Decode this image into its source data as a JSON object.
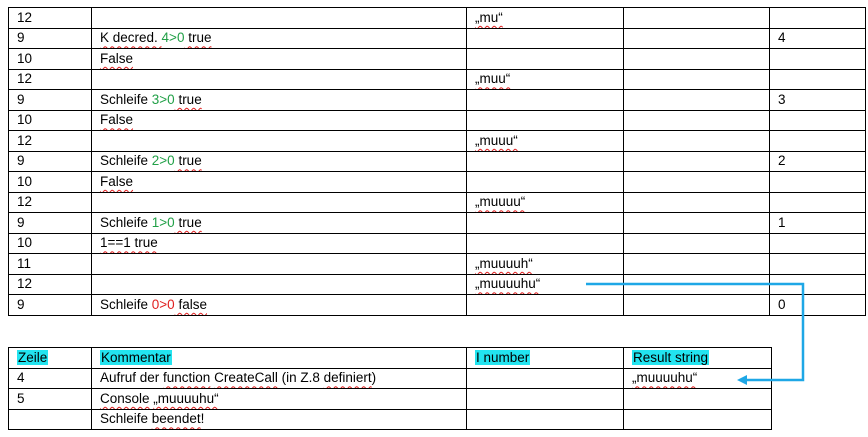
{
  "trace_rows": [
    {
      "zeile": "12",
      "pre": "",
      "num": "",
      "post": "",
      "string": "„mu“",
      "result": "",
      "count": ""
    },
    {
      "zeile": "9",
      "pre": "K decred. ",
      "num": "4>0",
      "post": " true",
      "string": "",
      "result": "",
      "count": "4"
    },
    {
      "zeile": "10",
      "pre": "False",
      "num": "",
      "post": "",
      "string": "",
      "result": "",
      "count": ""
    },
    {
      "zeile": "12",
      "pre": "",
      "num": "",
      "post": "",
      "string": "„muu“",
      "result": "",
      "count": ""
    },
    {
      "zeile": "9",
      "pre": "Schleife ",
      "num": "3>0",
      "post": " true",
      "string": "",
      "result": "",
      "count": "3"
    },
    {
      "zeile": "10",
      "pre": "False",
      "num": "",
      "post": "",
      "string": "",
      "result": "",
      "count": ""
    },
    {
      "zeile": "12",
      "pre": "",
      "num": "",
      "post": "",
      "string": "„muuu“",
      "result": "",
      "count": ""
    },
    {
      "zeile": "9",
      "pre": "Schleife ",
      "num": "2>0",
      "post": " true",
      "string": "",
      "result": "",
      "count": "2"
    },
    {
      "zeile": "10",
      "pre": "False",
      "num": "",
      "post": "",
      "string": "",
      "result": "",
      "count": ""
    },
    {
      "zeile": "12",
      "pre": "",
      "num": "",
      "post": "",
      "string": "„muuuu“",
      "result": "",
      "count": ""
    },
    {
      "zeile": "9",
      "pre": "Schleife ",
      "num": "1>0",
      "post": " true",
      "string": "",
      "result": "",
      "count": "1"
    },
    {
      "zeile": "10",
      "pre": "1==1 true",
      "num": "",
      "post": "",
      "string": "",
      "result": "",
      "count": ""
    },
    {
      "zeile": "11",
      "pre": "",
      "num": "",
      "post": "",
      "string": "„muuuuh“",
      "result": "",
      "count": ""
    },
    {
      "zeile": "12",
      "pre": "",
      "num": "",
      "post": "",
      "string": "„muuuuhu“",
      "result": "",
      "count": ""
    },
    {
      "zeile": "9",
      "pre": "Schleife ",
      "num": "0>0",
      "post": " false",
      "string": "",
      "result": "",
      "count": "0"
    }
  ],
  "legend": {
    "headers": {
      "zeile": "Zeile",
      "kommentar": "Kommentar",
      "number": "I number",
      "result": "Result string"
    },
    "rows": [
      {
        "zeile": "4",
        "kommentar": "Aufruf der function CreateCall (in Z.8 definiert)",
        "number": "",
        "result": "„muuuuhu“"
      },
      {
        "zeile": "5",
        "kommentar": "Console „muuuuhu“",
        "number": "",
        "result": ""
      },
      {
        "zeile": "",
        "kommentar": "Schleife beendet!",
        "number": "",
        "result": ""
      }
    ]
  },
  "colors": {
    "true_number": "#21a047",
    "false_number": "#e02020",
    "header_highlight": "#22e4f0",
    "arrow": "#1ea7e6",
    "spell_underline": "#e02020"
  }
}
